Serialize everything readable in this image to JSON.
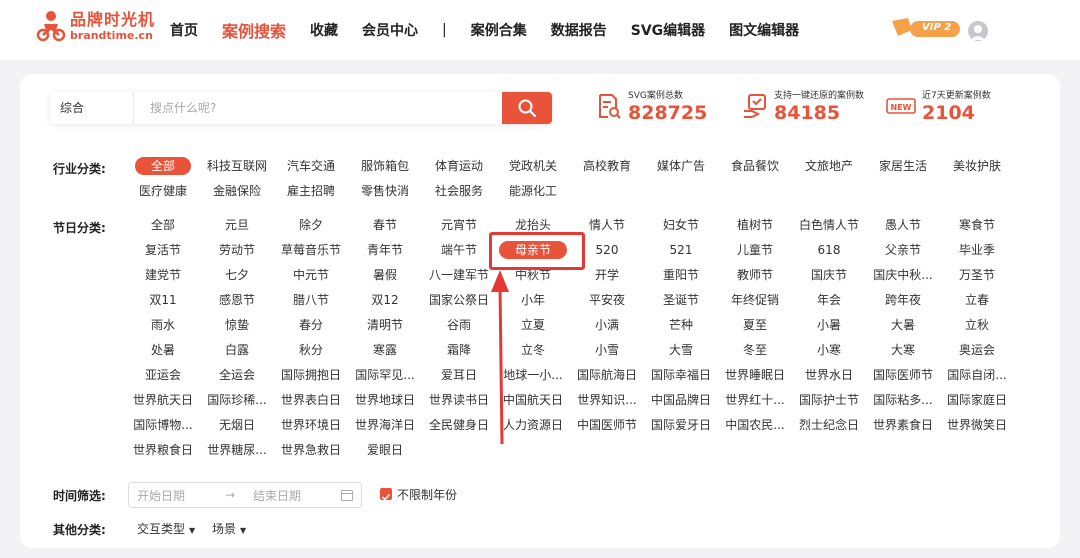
{
  "brand": {
    "name_cn": "品牌时光机",
    "name_en": "brandtime.cn",
    "color": "#e8533a"
  },
  "nav": [
    {
      "label": "首页",
      "active": false
    },
    {
      "label": "案例搜索",
      "active": true
    },
    {
      "label": "收藏",
      "active": false
    },
    {
      "label": "会员中心",
      "active": false
    },
    {
      "label": "|",
      "sep": true
    },
    {
      "label": "案例合集",
      "active": false
    },
    {
      "label": "数据报告",
      "active": false
    },
    {
      "label": "SVG编辑器",
      "active": false
    },
    {
      "label": "图文编辑器",
      "active": false
    }
  ],
  "vip_badge": "VIP 2",
  "search": {
    "type": "综合",
    "placeholder": "搜点什么呢?",
    "button_icon": "search-icon"
  },
  "stats": [
    {
      "label": "SVG案例总数",
      "value": "828725",
      "icon": "document-search-icon"
    },
    {
      "label": "支持一键还原的案例数",
      "value": "84185",
      "icon": "restore-hand-icon"
    },
    {
      "label": "近7天更新案例数",
      "value": "2104",
      "icon": "new-badge-icon"
    }
  ],
  "industry": {
    "label": "行业分类:",
    "items": [
      "全部",
      "科技互联网",
      "汽车交通",
      "服饰箱包",
      "体育运动",
      "党政机关",
      "高校教育",
      "媒体广告",
      "食品餐饮",
      "文旅地产",
      "家居生活",
      "美妆护肤",
      "医疗健康",
      "金融保险",
      "雇主招聘",
      "零售快消",
      "社会服务",
      "能源化工"
    ],
    "active": "全部"
  },
  "festival": {
    "label": "节日分类:",
    "items": [
      "全部",
      "元旦",
      "除夕",
      "春节",
      "元宵节",
      "龙抬头",
      "情人节",
      "妇女节",
      "植树节",
      "白色情人节",
      "愚人节",
      "寒食节",
      "复活节",
      "劳动节",
      "草莓音乐节",
      "青年节",
      "端午节",
      "母亲节",
      "520",
      "521",
      "儿童节",
      "618",
      "父亲节",
      "毕业季",
      "建党节",
      "七夕",
      "中元节",
      "暑假",
      "八一建军节",
      "中秋节",
      "开学",
      "重阳节",
      "教师节",
      "国庆节",
      "国庆中秋...",
      "万圣节",
      "双11",
      "感恩节",
      "腊八节",
      "双12",
      "国家公祭日",
      "小年",
      "平安夜",
      "圣诞节",
      "年终促销",
      "年会",
      "跨年夜",
      "立春",
      "雨水",
      "惊蛰",
      "春分",
      "清明节",
      "谷雨",
      "立夏",
      "小满",
      "芒种",
      "夏至",
      "小暑",
      "大暑",
      "立秋",
      "处暑",
      "白露",
      "秋分",
      "寒露",
      "霜降",
      "立冬",
      "小雪",
      "大雪",
      "冬至",
      "小寒",
      "大寒",
      "奥运会",
      "亚运会",
      "全运会",
      "国际拥抱日",
      "国际罕见...",
      "爱耳日",
      "地球一小...",
      "国际航海日",
      "国际幸福日",
      "世界睡眠日",
      "世界水日",
      "国际医师节",
      "国际自闭...",
      "世界航天日",
      "国际珍稀...",
      "世界表白日",
      "世界地球日",
      "世界读书日",
      "中国航天日",
      "世界知识...",
      "中国品牌日",
      "世界红十...",
      "国际护士节",
      "国际粘多...",
      "国际家庭日",
      "国际博物...",
      "无烟日",
      "世界环境日",
      "世界海洋日",
      "全民健身日",
      "人力资源日",
      "中国医师节",
      "国际爱牙日",
      "中国农民...",
      "烈士纪念日",
      "世界素食日",
      "世界微笑日",
      "世界粮食日",
      "世界糖尿...",
      "世界急救日",
      "爱眼日"
    ],
    "active": "母亲节"
  },
  "time_filter": {
    "label": "时间筛选:",
    "start_placeholder": "开始日期",
    "arrow": "→",
    "end_placeholder": "结束日期",
    "checkbox_label": "不限制年份",
    "checked": true
  },
  "other": {
    "label": "其他分类:",
    "dropdowns": [
      "交互类型",
      "场景"
    ]
  }
}
